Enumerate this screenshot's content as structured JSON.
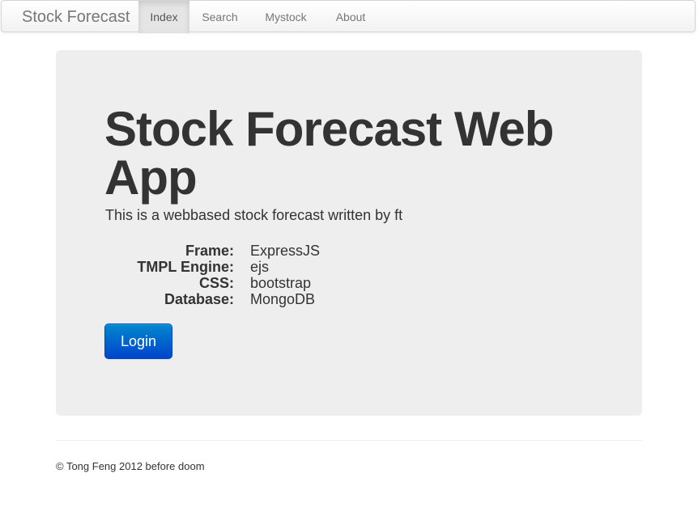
{
  "navbar": {
    "brand": "Stock Forecast",
    "items": [
      {
        "label": "Index",
        "active": true
      },
      {
        "label": "Search",
        "active": false
      },
      {
        "label": "Mystock",
        "active": false
      },
      {
        "label": "About",
        "active": false
      }
    ]
  },
  "hero": {
    "title": "Stock Forecast Web App",
    "subtitle": "This is a webbased stock forecast written by ft",
    "info": [
      {
        "label": "Frame:",
        "value": "ExpressJS"
      },
      {
        "label": "TMPL Engine:",
        "value": "ejs"
      },
      {
        "label": "CSS:",
        "value": "bootstrap"
      },
      {
        "label": "Database:",
        "value": "MongoDB"
      }
    ],
    "login_label": "Login"
  },
  "footer": {
    "text": "© Tong Feng 2012 before doom"
  },
  "colors": {
    "primary": "#0044cc",
    "hero_bg": "#eeeeee"
  }
}
